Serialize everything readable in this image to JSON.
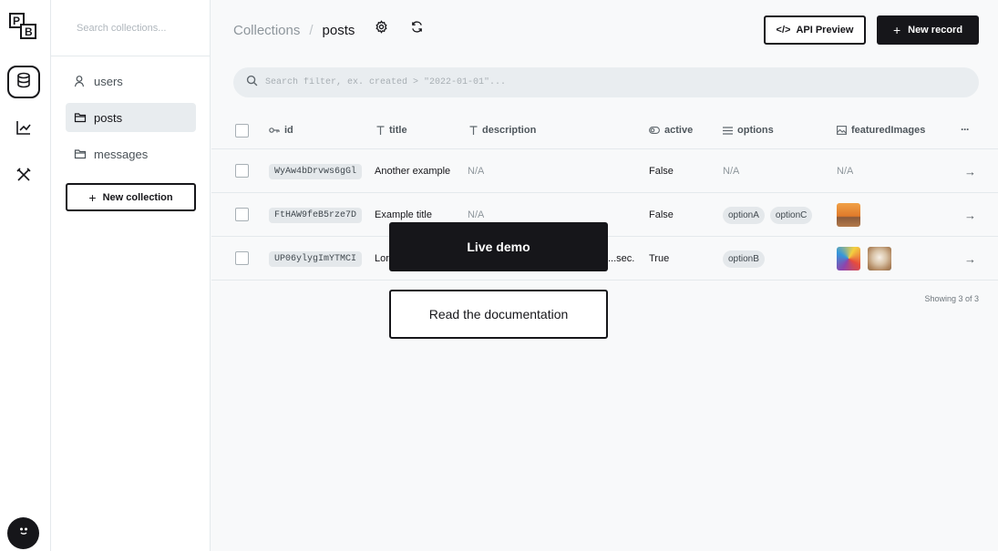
{
  "logo": {
    "letters": [
      "P",
      "B"
    ]
  },
  "rail": {
    "items": [
      {
        "name": "collections",
        "icon": "database-icon",
        "active": true
      },
      {
        "name": "logs",
        "icon": "chart-line-icon",
        "active": false
      },
      {
        "name": "settings",
        "icon": "tools-icon",
        "active": false
      }
    ],
    "avatar_icon": "avatar-smile-icon"
  },
  "sidebar": {
    "search_placeholder": "Search collections...",
    "items": [
      {
        "label": "users",
        "icon": "user-icon",
        "active": false
      },
      {
        "label": "posts",
        "icon": "folder-icon",
        "active": true
      },
      {
        "label": "messages",
        "icon": "folder-icon",
        "active": false
      }
    ],
    "new_collection_label": "New collection"
  },
  "header": {
    "breadcrumb_parent": "Collections",
    "breadcrumb_separator": "/",
    "breadcrumb_current": "posts",
    "api_preview_label": "API Preview",
    "new_record_label": "New record"
  },
  "filter": {
    "placeholder": "Search filter, ex. created > \"2022-01-01\"..."
  },
  "table": {
    "columns": [
      {
        "label": "id",
        "icon": "key-icon"
      },
      {
        "label": "title",
        "icon": "text-icon"
      },
      {
        "label": "description",
        "icon": "text-icon"
      },
      {
        "label": "active",
        "icon": "toggle-icon"
      },
      {
        "label": "options",
        "icon": "list-icon"
      },
      {
        "label": "featuredImages",
        "icon": "image-icon"
      }
    ],
    "more_label": "···",
    "rows": [
      {
        "id": "WyAw4bDrvws6gGl",
        "title": "Another example",
        "description": "N/A",
        "active": "False",
        "options": [],
        "options_na": "N/A",
        "images_na": "N/A"
      },
      {
        "id": "FtHAW9feB5rze7D",
        "title": "Example title",
        "description": "N/A",
        "active": "False",
        "options": [
          "optionA",
          "optionC"
        ]
      },
      {
        "id": "UP06ylygImYTMCI",
        "title": "Lor",
        "description": "...sec...",
        "active": "True",
        "options": [
          "optionB"
        ]
      }
    ],
    "showing": "Showing 3 of 3"
  },
  "overlay": {
    "live_demo_label": "Live demo",
    "docs_label": "Read the documentation"
  }
}
